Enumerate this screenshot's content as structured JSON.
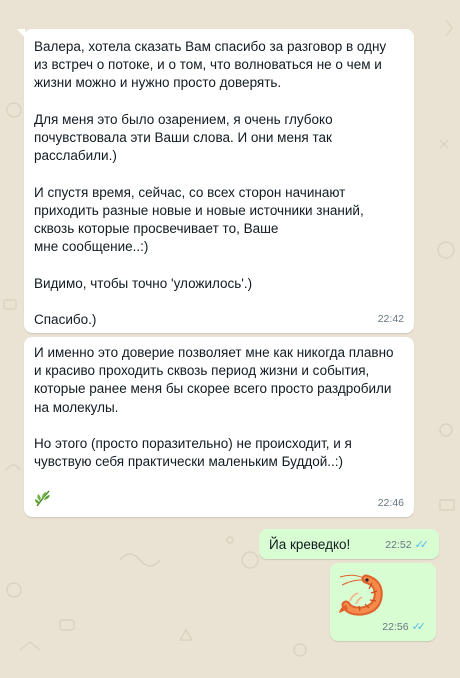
{
  "messages": [
    {
      "paragraphs": [
        "Валера, хотела сказать Вам спасибо за разговор в одну\nиз встреч о потоке, и о том, что волноваться не о чем и\nжизни можно и нужно просто доверять.",
        "Для меня это было озарением, я очень глубоко\nпочувствовала эти Ваши слова. И они меня так\nрасслабили.)",
        "И спустя время, сейчас, со всех сторон начинают\nприходить разные новые и новые источники знаний,\nсквозь которые просвечивает то, Ваше\nмне сообщение..:)",
        "Видимо, чтобы точно 'уложилось'.)",
        "Спасибо.)"
      ],
      "time": "22:42"
    },
    {
      "paragraphs": [
        "И именно это доверие позволяет мне как никогда плавно\nи красиво проходить сквозь период жизни и события,\nкоторые ранее меня бы скорее всего просто раздробили\nна молекулы.",
        "Но этого (просто поразительно) не происходит, и я\nчувствую себя практически маленьким Буддой..:)"
      ],
      "emoji": "herb",
      "time": "22:46"
    },
    {
      "text": "Йа креведко!",
      "time": "22:52",
      "status": "read"
    },
    {
      "emoji": "shrimp",
      "time": "22:56",
      "status": "read"
    }
  ],
  "colors": {
    "background": "#eae3d3",
    "incoming_bubble": "#ffffff",
    "outgoing_bubble": "#d9fdd3",
    "read_ticks": "#53bdeb",
    "timestamp": "#667781"
  }
}
